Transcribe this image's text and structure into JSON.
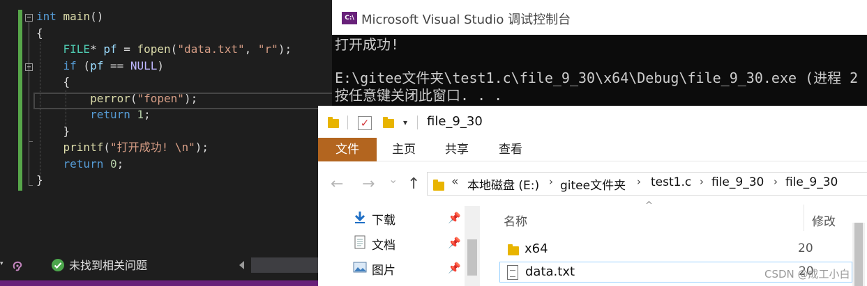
{
  "editor": {
    "lines": [
      [
        {
          "t": "int",
          "c": "kw"
        },
        {
          "t": " main",
          "c": "fn"
        },
        {
          "t": "()",
          "c": "pu"
        }
      ],
      [
        {
          "t": "{",
          "c": "pu"
        }
      ],
      [
        {
          "t": "    ",
          "c": "pu"
        },
        {
          "t": "FILE",
          "c": "ty"
        },
        {
          "t": "* ",
          "c": "pu"
        },
        {
          "t": "pf",
          "c": "va"
        },
        {
          "t": " = ",
          "c": "pu"
        },
        {
          "t": "fopen",
          "c": "fn"
        },
        {
          "t": "(",
          "c": "pu"
        },
        {
          "t": "\"data.txt\"",
          "c": "st"
        },
        {
          "t": ", ",
          "c": "pu"
        },
        {
          "t": "\"r\"",
          "c": "st"
        },
        {
          "t": ");",
          "c": "pu"
        }
      ],
      [
        {
          "t": "    ",
          "c": "pu"
        },
        {
          "t": "if",
          "c": "kw"
        },
        {
          "t": " (",
          "c": "pu"
        },
        {
          "t": "pf",
          "c": "va"
        },
        {
          "t": " == ",
          "c": "pu"
        },
        {
          "t": "NULL",
          "c": "mc"
        },
        {
          "t": ")",
          "c": "pu"
        }
      ],
      [
        {
          "t": "    {",
          "c": "pu"
        }
      ],
      [
        {
          "t": "        ",
          "c": "pu"
        },
        {
          "t": "perror",
          "c": "fn"
        },
        {
          "t": "(",
          "c": "pu"
        },
        {
          "t": "\"fopen\"",
          "c": "st"
        },
        {
          "t": ");",
          "c": "pu"
        }
      ],
      [
        {
          "t": "        ",
          "c": "pu"
        },
        {
          "t": "return",
          "c": "kw"
        },
        {
          "t": " ",
          "c": "pu"
        },
        {
          "t": "1",
          "c": "nm"
        },
        {
          "t": ";",
          "c": "pu"
        }
      ],
      [
        {
          "t": "    }",
          "c": "pu"
        }
      ],
      [
        {
          "t": "    ",
          "c": "pu"
        },
        {
          "t": "printf",
          "c": "fn"
        },
        {
          "t": "(",
          "c": "pu"
        },
        {
          "t": "\"打开成功! \\n\"",
          "c": "st"
        },
        {
          "t": ");",
          "c": "pu"
        }
      ],
      [
        {
          "t": "    ",
          "c": "pu"
        },
        {
          "t": "return",
          "c": "kw"
        },
        {
          "t": " ",
          "c": "pu"
        },
        {
          "t": "0",
          "c": "nm"
        },
        {
          "t": ";",
          "c": "pu"
        }
      ],
      [
        {
          "t": "}",
          "c": "pu"
        }
      ]
    ],
    "status_text": "未找到相关问题",
    "status_dropdown": "▾",
    "status_check_icon": "✓",
    "fold_minus": "−",
    "colors": {
      "change_bar": "#57a64a",
      "status_bar": "#68217a"
    }
  },
  "console": {
    "title": "Microsoft Visual Studio 调试控制台",
    "icon_label": "C:\\",
    "lines": [
      "打开成功!",
      "",
      "E:\\gitee文件夹\\test1.c\\file_9_30\\x64\\Debug\\file_9_30.exe (进程 2",
      "按任意键关闭此窗口. . ."
    ]
  },
  "explorer": {
    "title": "file_9_30",
    "qat_check": "✓",
    "qat_dropdown": "▾",
    "tabs": [
      {
        "label": "文件",
        "active": true
      },
      {
        "label": "主页",
        "active": false
      },
      {
        "label": "共享",
        "active": false
      },
      {
        "label": "查看",
        "active": false
      }
    ],
    "nav_back": "←",
    "nav_forward": "→",
    "nav_recent": "⌄",
    "nav_up": "↑",
    "breadcrumb_prefix": "«",
    "breadcrumb": [
      "本地磁盘 (E:)",
      "gitee文件夹",
      "test1.c",
      "file_9_30",
      "file_9_30"
    ],
    "breadcrumb_sep": "›",
    "quick_access": [
      {
        "label": "下载",
        "icon": "download-icon"
      },
      {
        "label": "文档",
        "icon": "document-icon"
      },
      {
        "label": "图片",
        "icon": "picture-icon"
      }
    ],
    "pin_glyph": "📌",
    "columns": {
      "name": "名称",
      "modified": "修改"
    },
    "sort_caret": "^",
    "files": [
      {
        "name": "x64",
        "date": "20",
        "type": "folder"
      },
      {
        "name": "data.txt",
        "date": "20",
        "type": "text-file"
      }
    ]
  },
  "watermark": "CSDN @成工小白"
}
